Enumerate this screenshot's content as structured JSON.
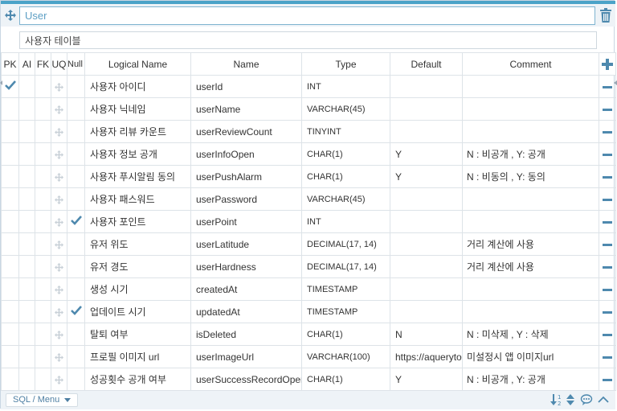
{
  "table": {
    "name": "User",
    "comment": "사용자 테이블"
  },
  "headers": {
    "pk": "PK",
    "ai": "AI",
    "fk": "FK",
    "uq": "UQ",
    "null": "Null",
    "logical": "Logical Name",
    "name": "Name",
    "type": "Type",
    "default": "Default",
    "comment": "Comment"
  },
  "rows": [
    {
      "pk": true,
      "nn": false,
      "logical": "사용자 아이디",
      "name": "userId",
      "type": "INT",
      "default": "",
      "comment": ""
    },
    {
      "pk": false,
      "nn": false,
      "logical": "사용자 닉네임",
      "name": "userName",
      "type": "VARCHAR(45)",
      "default": "",
      "comment": ""
    },
    {
      "pk": false,
      "nn": false,
      "logical": "사용자 리뷰 카운트",
      "name": "userReviewCount",
      "type": "TINYINT",
      "default": "",
      "comment": ""
    },
    {
      "pk": false,
      "nn": false,
      "logical": "사용자 정보 공개",
      "name": "userInfoOpen",
      "type": "CHAR(1)",
      "default": "Y",
      "comment": "N : 비공개 , Y: 공개"
    },
    {
      "pk": false,
      "nn": false,
      "logical": "사용자 푸시알림 동의",
      "name": "userPushAlarm",
      "type": "CHAR(1)",
      "default": "Y",
      "comment": "N : 비동의 , Y: 동의"
    },
    {
      "pk": false,
      "nn": false,
      "logical": "사용자 패스워드",
      "name": "userPassword",
      "type": "VARCHAR(45)",
      "default": "",
      "comment": ""
    },
    {
      "pk": false,
      "nn": true,
      "logical": "사용자 포인트",
      "name": "userPoint",
      "type": "INT",
      "default": "",
      "comment": ""
    },
    {
      "pk": false,
      "nn": false,
      "logical": "유저 위도",
      "name": "userLatitude",
      "type": "DECIMAL(17, 14)",
      "default": "",
      "comment": "거리 계산에 사용"
    },
    {
      "pk": false,
      "nn": false,
      "logical": "유저 경도",
      "name": "userHardness",
      "type": "DECIMAL(17, 14)",
      "default": "",
      "comment": "거리 계산에 사용"
    },
    {
      "pk": false,
      "nn": false,
      "logical": "생성 시기",
      "name": "createdAt",
      "type": "TIMESTAMP",
      "default": "",
      "comment": ""
    },
    {
      "pk": false,
      "nn": true,
      "logical": "업데이트 시기",
      "name": "updatedAt",
      "type": "TIMESTAMP",
      "default": "",
      "comment": ""
    },
    {
      "pk": false,
      "nn": false,
      "logical": "탈퇴 여부",
      "name": "isDeleted",
      "type": "CHAR(1)",
      "default": "N",
      "comment": "N : 미삭제 , Y : 삭제"
    },
    {
      "pk": false,
      "nn": false,
      "logical": "프로필 이미지 url",
      "name": "userImageUrl",
      "type": "VARCHAR(100)",
      "default": "https://aqueryto",
      "comment": "미설정시 앱 이미지url"
    },
    {
      "pk": false,
      "nn": false,
      "logical": "성공횟수 공개 여부",
      "name": "userSuccessRecordOpen",
      "type": "CHAR(1)",
      "default": "Y",
      "comment": "N : 비공개 , Y: 공개"
    }
  ],
  "footer": {
    "menu_label": "SQL / Menu"
  },
  "icons": {
    "move": "move-icon",
    "trash": "trash-icon",
    "grip": "drag-grip-icon",
    "check": "check-icon",
    "add": "plus-icon",
    "remove": "minus-icon",
    "sort": "sort-az-icon",
    "updown": "up-down-icon",
    "chat": "comment-icon",
    "collapse": "chevron-up-icon"
  },
  "colors": {
    "accent": "#4e89ae",
    "stripe": "#4aa3c8",
    "title_text": "#5d9fc4",
    "panel_bg": "#eef3f7",
    "border": "#dde3e8"
  }
}
